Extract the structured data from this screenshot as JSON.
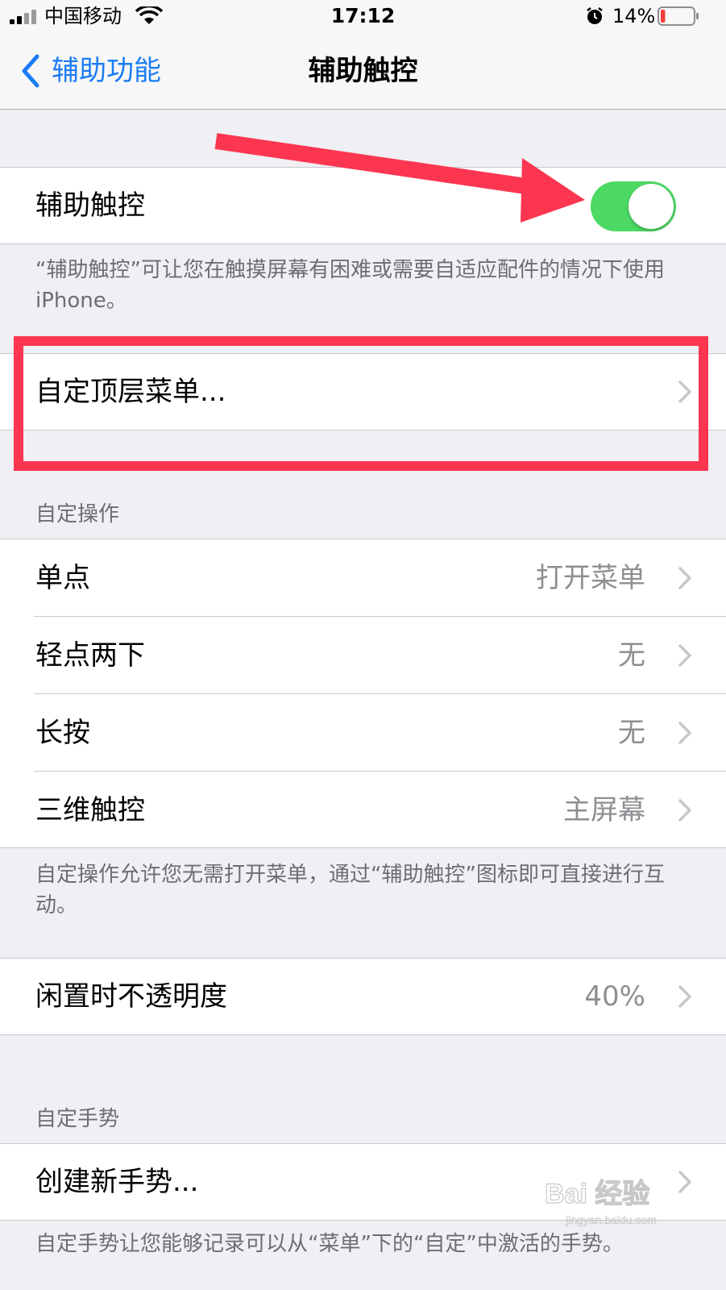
{
  "status_bar": {
    "carrier": "中国移动",
    "time": "17:12",
    "battery_percent": "14%",
    "battery_level": 0.14
  },
  "nav": {
    "back_label": "辅助功能",
    "title": "辅助触控"
  },
  "assistive_touch": {
    "label": "辅助触控",
    "enabled": true,
    "toggle_color": "#4cd964",
    "description": "“辅助触控”可让您在触摸屏幕有困难或需要自适应配件的情况下使用 iPhone。"
  },
  "top_menu": {
    "label": "自定顶层菜单..."
  },
  "custom_actions": {
    "header": "自定操作",
    "rows": [
      {
        "label": "单点",
        "value": "打开菜单"
      },
      {
        "label": "轻点两下",
        "value": "无"
      },
      {
        "label": "长按",
        "value": "无"
      },
      {
        "label": "三维触控",
        "value": "主屏幕"
      }
    ],
    "footer": "自定操作允许您无需打开菜单，通过“辅助触控”图标即可直接进行互动。"
  },
  "idle_opacity": {
    "label": "闲置时不透明度",
    "value": "40%"
  },
  "custom_gestures": {
    "header": "自定手势",
    "create_label": "创建新手势...",
    "footer": "自定手势让您能够记录可以从“菜单”下的“自定”中激活的手势。"
  },
  "watermark": {
    "text": "Bai 经验",
    "subtext": "jingyan.baidu.com"
  },
  "colors": {
    "accent_blue": "#1a7cf5",
    "annotation_red": "#fc3650"
  }
}
